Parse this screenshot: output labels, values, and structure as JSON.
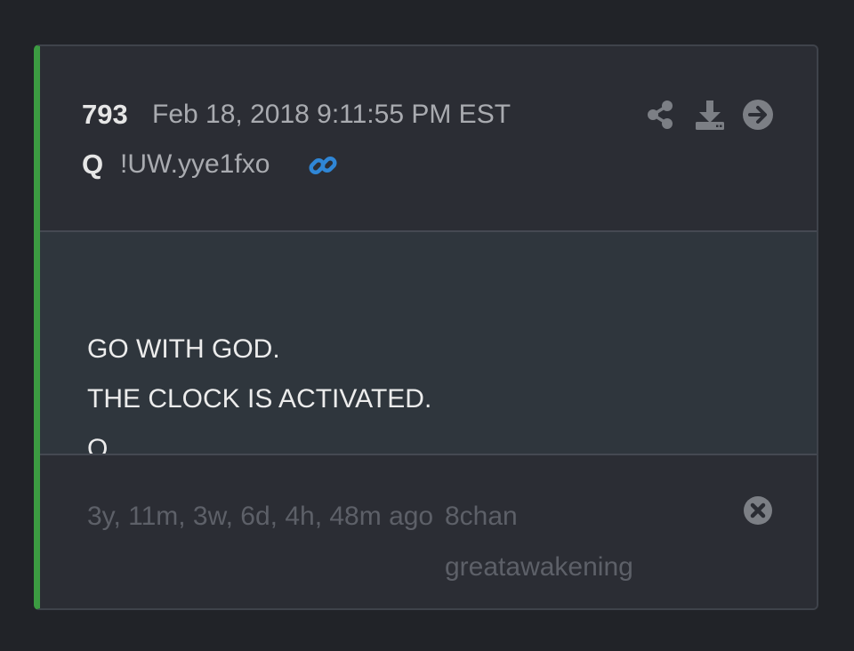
{
  "post": {
    "number": "793",
    "timestamp": "Feb 18, 2018 9:11:55 PM EST",
    "author": "Q",
    "tripcode": "!UW.yye1fxo",
    "body_lines": [
      "GO WITH GOD.",
      "THE CLOCK IS ACTIVATED.",
      "Q"
    ],
    "age": "3y, 11m, 3w, 6d, 4h, 48m ago",
    "source": "8chan greatawakening"
  },
  "icons": {
    "link": "link-icon",
    "share": "share-icon",
    "download": "download-icon",
    "open": "arrow-right-circle-icon",
    "close": "close-circle-icon"
  },
  "colors": {
    "background": "#212328",
    "card": "#2b2d34",
    "body_panel": "#2f363d",
    "accent_bar": "#3c9b42",
    "link_blue": "#2f86d6",
    "icon_gray": "#7c7f85",
    "muted_text": "#5d6068"
  }
}
